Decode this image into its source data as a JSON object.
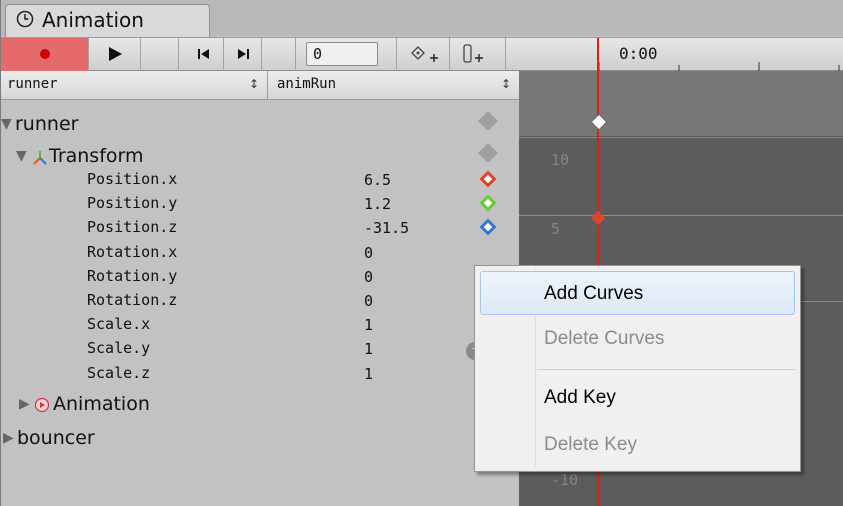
{
  "tab": {
    "label": "Animation",
    "icon": "clock-icon"
  },
  "toolbar": {
    "record_icon": "record-icon",
    "play_icon": "play-icon",
    "prev_key_icon": "previous-keyframe-icon",
    "next_key_icon": "next-keyframe-icon",
    "frame_value": "0",
    "add_key_icon": "add-keyframe-icon",
    "add_event_icon": "add-event-icon",
    "time_label": "0:00"
  },
  "header": {
    "object": "runner",
    "clip": "animRun"
  },
  "hierarchy": {
    "root": "runner",
    "transform": "Transform",
    "properties": [
      {
        "name": "Position.x",
        "value": "6.5",
        "key_color": "#e0452b"
      },
      {
        "name": "Position.y",
        "value": "1.2",
        "key_color": "#6acb2e"
      },
      {
        "name": "Position.z",
        "value": "-31.5",
        "key_color": "#3a77d8"
      },
      {
        "name": "Rotation.x",
        "value": "0"
      },
      {
        "name": "Rotation.y",
        "value": "0"
      },
      {
        "name": "Rotation.z",
        "value": "0"
      },
      {
        "name": "Scale.x",
        "value": "1"
      },
      {
        "name": "Scale.y",
        "value": "1"
      },
      {
        "name": "Scale.z",
        "value": "1"
      }
    ],
    "animation": "Animation",
    "bouncer": "bouncer"
  },
  "curve": {
    "y_labels": [
      "10",
      "5",
      "-10"
    ]
  },
  "context_menu": {
    "items": [
      {
        "label": "Add Curves",
        "enabled": true,
        "highlighted": true
      },
      {
        "label": "Delete Curves",
        "enabled": false
      },
      {
        "label": "Add Key",
        "enabled": true
      },
      {
        "label": "Delete Key",
        "enabled": false
      }
    ]
  },
  "colors": {
    "record": "#e66a6a",
    "playhead": "#e21c1c",
    "curve_bg": "#5c5c5c"
  }
}
